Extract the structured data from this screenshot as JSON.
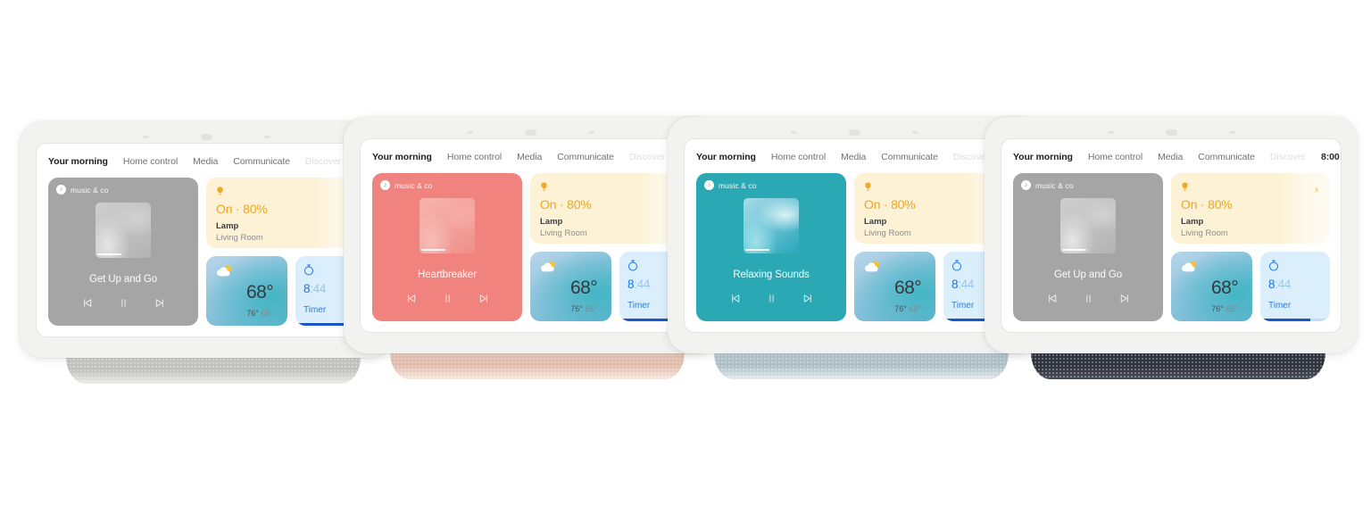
{
  "page": {
    "background": "#ffffff",
    "device_count": 4
  },
  "tabs": [
    {
      "label": "Your morning",
      "state": "active"
    },
    {
      "label": "Home control",
      "state": "normal"
    },
    {
      "label": "Media",
      "state": "normal"
    },
    {
      "label": "Communicate",
      "state": "normal"
    },
    {
      "label": "Discover",
      "state": "muted"
    }
  ],
  "clock": "8:00",
  "media": {
    "brand": "music & co",
    "brand_icon": "music-badge-icon",
    "controls": {
      "previous": "skip-previous-icon",
      "pause": "pause-icon",
      "next": "skip-next-icon"
    }
  },
  "lamp": {
    "icon": "light-bulb-icon",
    "state": "On · 80%",
    "name": "Lamp",
    "room": "Living Room",
    "chevron": "chevron-right-icon",
    "accent": "#efa51f"
  },
  "weather": {
    "icon": "sun-behind-cloud-icon",
    "temperature": "68°",
    "high": "76°",
    "low": "65°"
  },
  "timer": {
    "icon": "timer-icon",
    "time_major": "8",
    "time_sep": ":",
    "time_minor": "44",
    "label": "Timer",
    "progress_percent": 72,
    "accent": "#1a73e8"
  },
  "devices": [
    {
      "id": "device-chalk",
      "finish": "Chalk",
      "base_colors": {
        "top": "#d4d5d3",
        "mid": "#bfc0be",
        "bottom": "#ebebe9"
      },
      "media": {
        "track": "Get Up and Go",
        "card_bg": "#a5a5a5",
        "art": {
          "bg": "#bdbdbd",
          "c1": "#e6e6e6",
          "c2": "#d2d2d2",
          "c3": "#cfcfcf",
          "c4": "#b3b3b3"
        }
      }
    },
    {
      "id": "device-sand",
      "finish": "Sand",
      "base_colors": {
        "top": "#eccfc2",
        "mid": "#e0baa9",
        "bottom": "#f6e6dd"
      },
      "media": {
        "track": "Heartbreaker",
        "card_bg": "#f0837e",
        "art": {
          "bg": "#f5a19c",
          "c1": "#f8bdb8",
          "c2": "#f6aca7",
          "c3": "#f7b4ae",
          "c4": "#ef8f89"
        }
      }
    },
    {
      "id": "device-mist",
      "finish": "Mist",
      "base_colors": {
        "top": "#c4d2d8",
        "mid": "#a9bcc4",
        "bottom": "#e2eaee"
      },
      "media": {
        "track": "Relaxing Sounds",
        "card_bg": "#2aa9b5",
        "art": {
          "bg": "#46b7c6",
          "c1": "#9fe0ea",
          "c2": "#d8f1f6",
          "c3": "#a8dce9",
          "c4": "#29a6bb"
        }
      }
    },
    {
      "id": "device-charcoal",
      "finish": "Charcoal",
      "base_colors": {
        "top": "#3a3f47",
        "mid": "#2b303a",
        "bottom": "#4a505a"
      },
      "media": {
        "track": "Get Up and Go",
        "card_bg": "#a5a5a5",
        "art": {
          "bg": "#bdbdbd",
          "c1": "#e6e6e6",
          "c2": "#d2d2d2",
          "c3": "#cfcfcf",
          "c4": "#b3b3b3"
        }
      }
    }
  ]
}
